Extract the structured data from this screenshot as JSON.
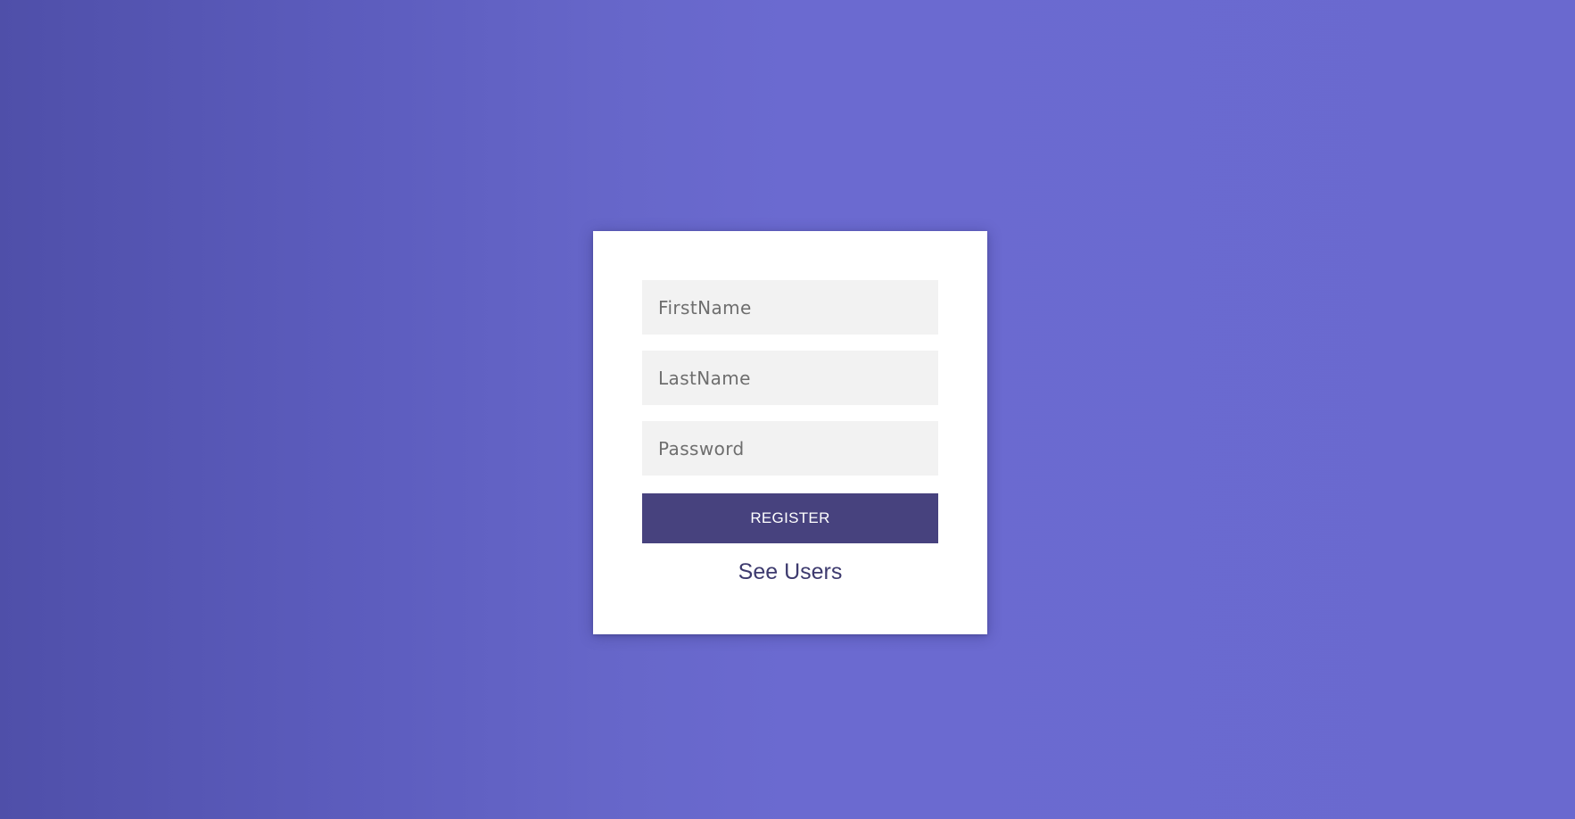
{
  "form": {
    "first_name": {
      "placeholder": "FirstName",
      "value": ""
    },
    "last_name": {
      "placeholder": "LastName",
      "value": ""
    },
    "password": {
      "placeholder": "Password",
      "value": ""
    },
    "register_label": "REGISTER",
    "see_users_label": "See Users"
  },
  "colors": {
    "background_gradient_start": "#4f4fa9",
    "background_gradient_end": "#6a69cf",
    "card": "#ffffff",
    "input_bg": "#f2f2f2",
    "button": "#47427e",
    "link": "#3d3a6e"
  }
}
